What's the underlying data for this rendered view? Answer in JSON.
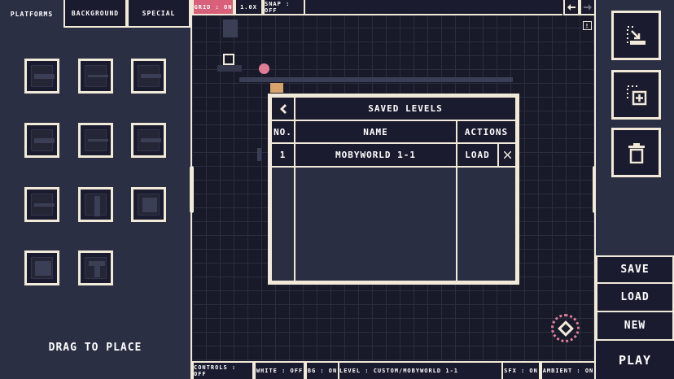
{
  "tabs": [
    "PLATFORMS",
    "BACKGROUND",
    "SPECIAL"
  ],
  "palette_hint": "DRAG TO PLACE",
  "toolbar": {
    "grid": "GRID : ON",
    "zoom": "1.0X",
    "snap": "SNAP : OFF",
    "info": "!"
  },
  "bottom_bar": {
    "controls": "CONTROLS : OFF",
    "white": "WHITE : OFF",
    "bg": "BG : ON",
    "level": "LEVEL : CUSTOM/MOBYWORLD 1-1",
    "sfx": "SFX : ON",
    "ambient": "AMBIENT : ON"
  },
  "modal": {
    "title": "SAVED LEVELS",
    "headers": {
      "no": "NO.",
      "name": "NAME",
      "actions": "ACTIONS"
    },
    "rows": [
      {
        "no": "1",
        "name": "MOBYWORLD 1-1",
        "action": "LOAD"
      }
    ]
  },
  "menu": {
    "save": "SAVE",
    "load": "LOAD",
    "new": "NEW",
    "play": "PLAY"
  },
  "icons": {
    "back": "chevron-left-icon",
    "delete_row": "close-icon",
    "undo": "arrow-left-icon",
    "redo": "arrow-right-icon",
    "import": "import-icon",
    "add": "add-icon",
    "trash": "trash-icon"
  },
  "colors": {
    "accent": "#d9607a",
    "panel": "#2b2f44",
    "canvas": "#181a2a",
    "border": "#f2ead9"
  }
}
